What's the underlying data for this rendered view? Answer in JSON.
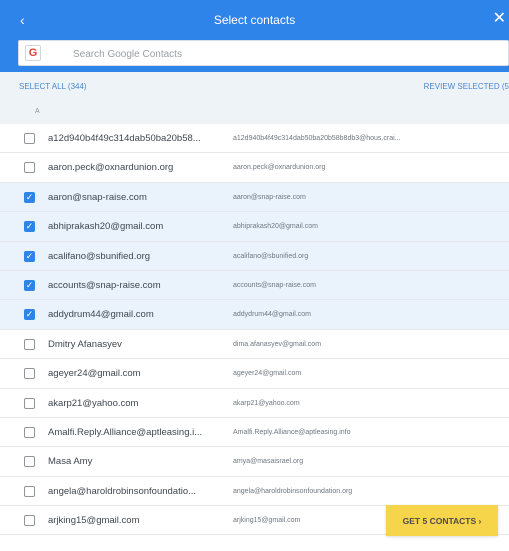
{
  "header": {
    "back_icon": "‹",
    "title": "Select contacts",
    "close_icon": "✕"
  },
  "search": {
    "logo": "G",
    "placeholder": "Search Google Contacts"
  },
  "toolbar": {
    "select_all": "SELECT ALL (344)",
    "review_selected": "REVIEW SELECTED (5"
  },
  "section": {
    "letter": "A"
  },
  "contacts": [
    {
      "name": "a12d940b4f49c314dab50ba20b58...",
      "email": "a12d940b4f49c314dab50ba20b58b8db3@hous.crai...",
      "checked": false
    },
    {
      "name": "aaron.peck@oxnardunion.org",
      "email": "aaron.peck@oxnardunion.org",
      "checked": false
    },
    {
      "name": "aaron@snap-raise.com",
      "email": "aaron@snap-raise.com",
      "checked": true
    },
    {
      "name": "abhiprakash20@gmail.com",
      "email": "abhiprakash20@gmail.com",
      "checked": true
    },
    {
      "name": "acalifano@sbunified.org",
      "email": "acalifano@sbunified.org",
      "checked": true
    },
    {
      "name": "accounts@snap-raise.com",
      "email": "accounts@snap-raise.com",
      "checked": true
    },
    {
      "name": "addydrum44@gmail.com",
      "email": "addydrum44@gmail.com",
      "checked": true
    },
    {
      "name": "Dmitry Afanasyev",
      "email": "dima.afanasyev@gmail.com",
      "checked": false
    },
    {
      "name": "ageyer24@gmail.com",
      "email": "ageyer24@gmail.com",
      "checked": false
    },
    {
      "name": "akarp21@yahoo.com",
      "email": "akarp21@yahoo.com",
      "checked": false
    },
    {
      "name": "Amalfi.Reply.Alliance@aptleasing.i...",
      "email": "Amalfi.Reply.Alliance@aptleasing.info",
      "checked": false
    },
    {
      "name": "Masa Amy",
      "email": "amya@masaisrael.org",
      "checked": false
    },
    {
      "name": "angela@haroldrobinsonfoundatio...",
      "email": "angela@haroldrobinsonfoundation.org",
      "checked": false
    },
    {
      "name": "arjking15@gmail.com",
      "email": "arjking15@gmail.com",
      "checked": false
    }
  ],
  "cta": {
    "label": "GET 5 CONTACTS ›"
  },
  "colors": {
    "header_blue": "#2f84ea",
    "cta_yellow": "#f7d54a",
    "selected_row": "#eaf2fb"
  }
}
